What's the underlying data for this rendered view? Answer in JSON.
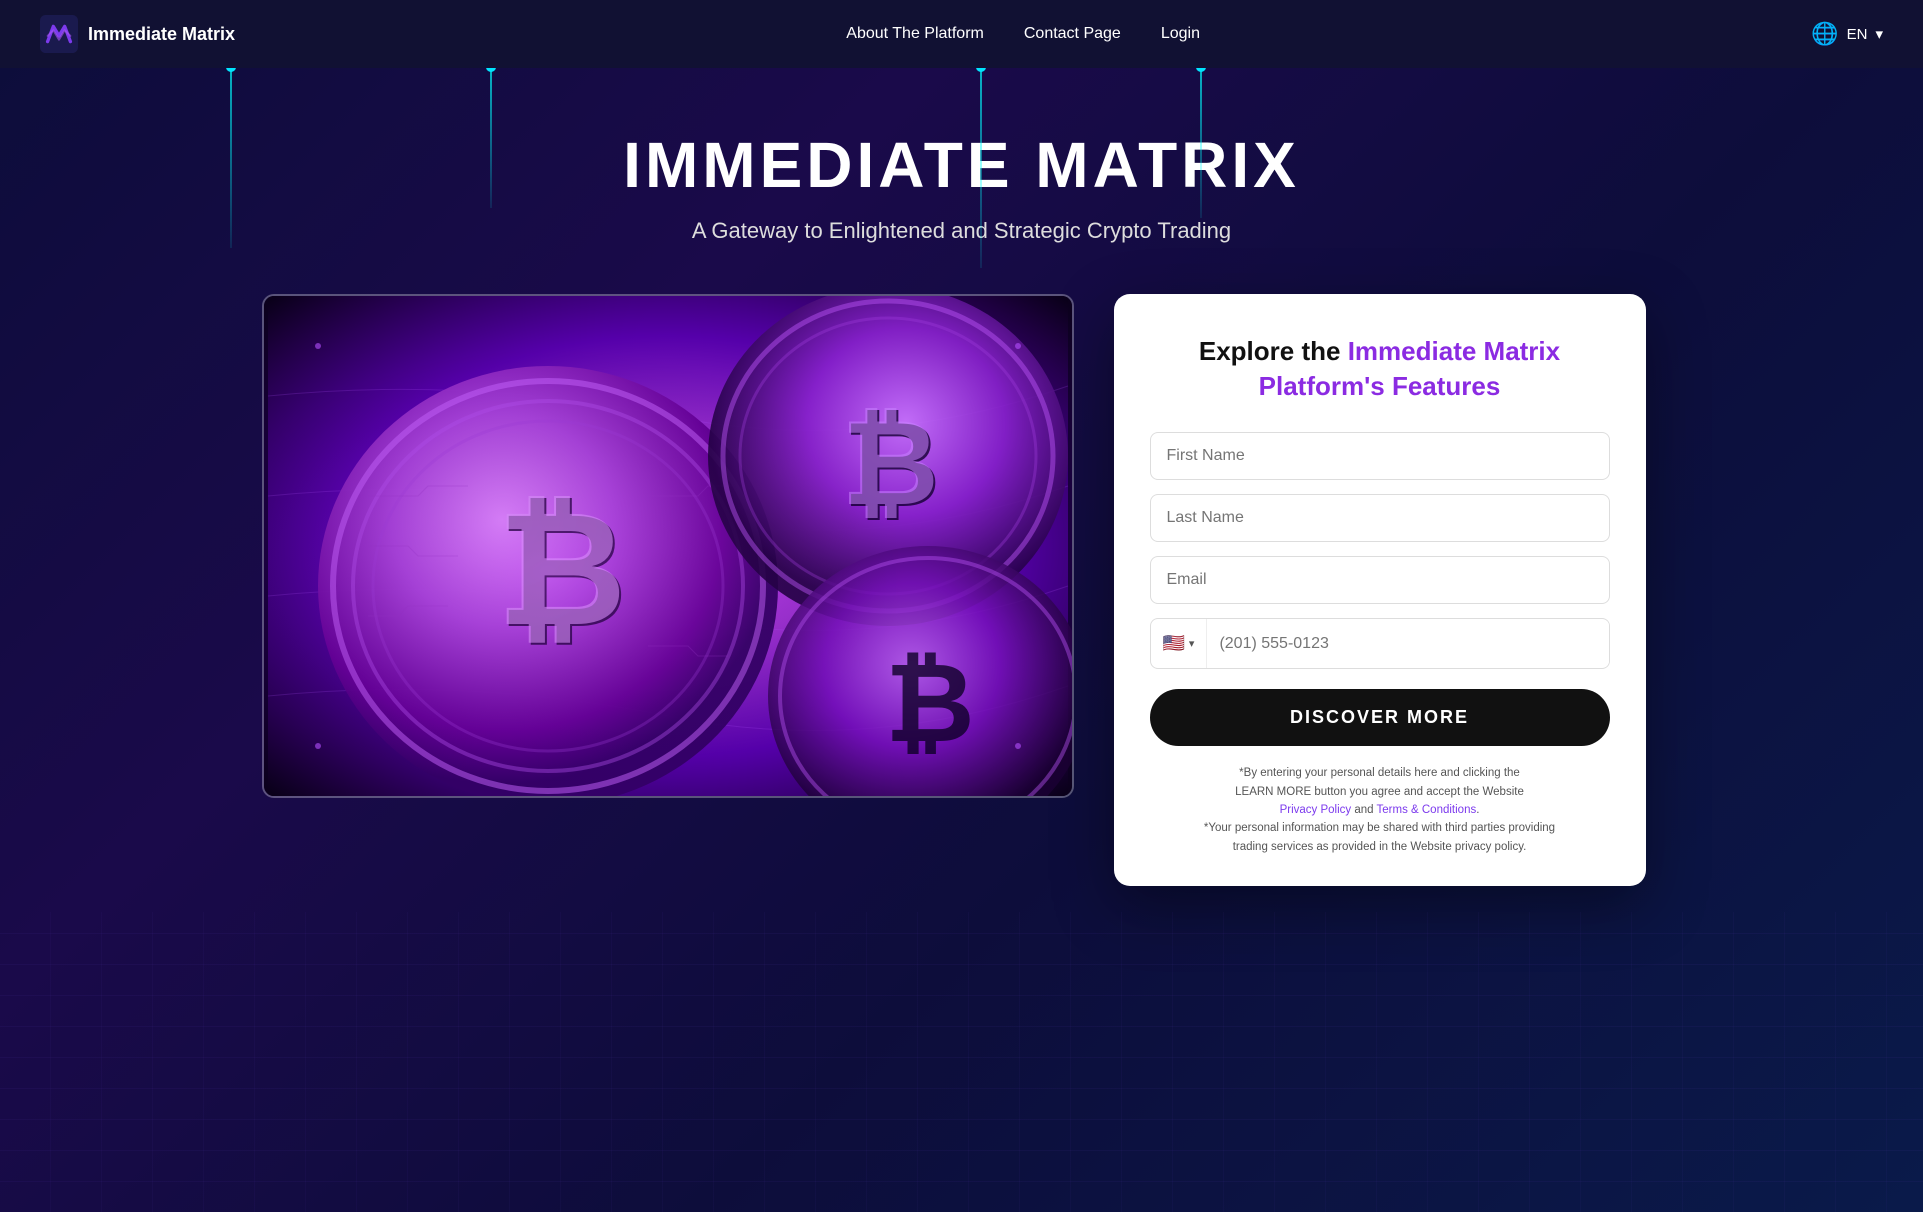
{
  "nav": {
    "logo_text": "Immediate Matrix",
    "links": [
      {
        "label": "About The Platform",
        "id": "about"
      },
      {
        "label": "Contact Page",
        "id": "contact"
      },
      {
        "label": "Login",
        "id": "login"
      }
    ],
    "lang": "EN"
  },
  "hero": {
    "main_title": "IMMEDIATE MATRIX",
    "subtitle": "A Gateway to Enlightened and Strategic Crypto Trading"
  },
  "form": {
    "title_plain": "Explore the ",
    "title_highlight": "Immediate Matrix Platform's Features",
    "first_name_placeholder": "First Name",
    "last_name_placeholder": "Last Name",
    "email_placeholder": "Email",
    "phone_flag": "🇺🇸",
    "phone_placeholder": "(201) 555-0123",
    "cta_label": "DISCOVER MORE",
    "disclaimer_line1": "*By entering your personal details here and clicking the",
    "disclaimer_line2": "LEARN MORE button you agree and accept the Website",
    "privacy_policy_label": "Privacy Policy",
    "and_text": " and ",
    "terms_label": "Terms & Conditions",
    "disclaimer_line3": ".",
    "disclaimer_line4": "*Your personal information may be shared with third parties providing",
    "disclaimer_line5": "trading services as provided in the Website privacy policy."
  }
}
